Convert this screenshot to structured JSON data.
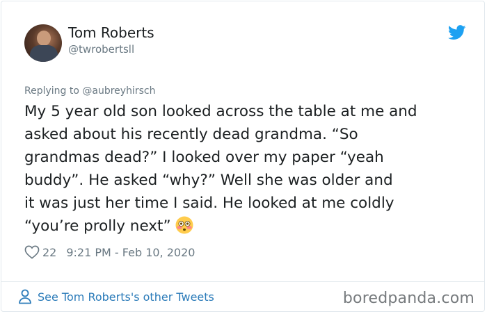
{
  "tweet": {
    "author_name": "Tom Roberts",
    "author_handle": "@twrobertsll",
    "replying_to": "Replying to @aubreyhirsch",
    "text": "My 5 year old son looked across the table at me and\nasked about his recently dead grandma.  “So\ngrandmas dead?”  I looked over my paper “yeah\nbuddy”.  He asked “why?”   Well she was older and\nit was just her time I said.  He looked at me coldly\n“you’re prolly next”",
    "emoji": "flushed-face",
    "likes": "22",
    "timestamp": "9:21 PM - Feb 10, 2020"
  },
  "footer": {
    "other_tweets_link": "See Tom Roberts's other Tweets",
    "watermark": "boredpanda.com"
  },
  "colors": {
    "twitter_blue": "#1da1f2",
    "link": "#2b7bb9",
    "muted": "#697882",
    "border": "#e1e8ed"
  }
}
